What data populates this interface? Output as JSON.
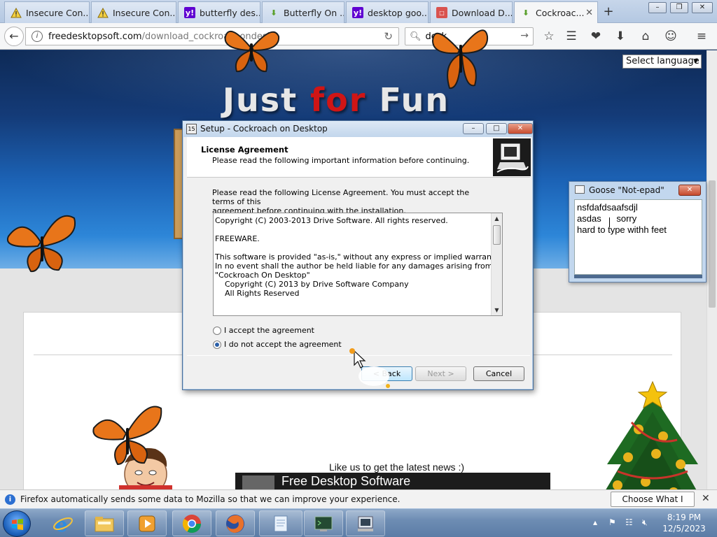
{
  "browser": {
    "tabs": [
      {
        "label": "Insecure Con...",
        "icon": "warning-icon"
      },
      {
        "label": "Insecure Con...",
        "icon": "warning-icon"
      },
      {
        "label": "butterfly des...",
        "icon": "yahoo-icon"
      },
      {
        "label": "Butterfly On ...",
        "icon": "download-arrow-icon"
      },
      {
        "label": "desktop goo...",
        "icon": "yahoo-icon"
      },
      {
        "label": "Download D...",
        "icon": "site-icon"
      },
      {
        "label": "Cockroac...",
        "icon": "download-arrow-icon",
        "active": true
      }
    ],
    "url_host": "freedesktopsoft.com",
    "url_path": "/download_cockroachondesk",
    "search_value": "desk"
  },
  "page": {
    "language_select": "Select language",
    "title_part1": "Just",
    "title_part2": "for",
    "title_part3": "Fun",
    "like_text": "Like us to get the latest news :)",
    "video_title": "Free Desktop Software"
  },
  "setup_dialog": {
    "title": "Setup - Cockroach on Desktop",
    "header_title": "License Agreement",
    "header_subtitle": "Please read the following important information before continuing.",
    "intro_line1": "Please read the following License Agreement. You must accept the terms of this",
    "intro_line2": "agreement before continuing with the installation.",
    "license_lines": [
      "Copyright (C) 2003-2013 Drive Software. All rights reserved.",
      "",
      "FREEWARE.",
      "",
      "This software is provided \"as-is,\" without any express or implied warranty.",
      "In no event shall the author be held liable for any damages arising from the",
      "\"Cockroach On Desktop\"",
      "    Copyright (C) 2013 by Drive Software Company",
      "    All Rights Reserved"
    ],
    "radio_accept": "I accept the agreement",
    "radio_decline": "I do not accept the agreement",
    "selected_option": "decline",
    "back_button": "< Back",
    "next_button": "Next >",
    "cancel_button": "Cancel"
  },
  "goose_notepad": {
    "title": "Goose \"Not-epad\"",
    "lines": [
      "nsfdafdsaafsdjl",
      "asdas      sorry",
      "hard to type withh feet"
    ]
  },
  "notification": {
    "message": "Firefox automatically sends some data to Mozilla so that we can improve your experience.",
    "button": "Choose What I Share"
  },
  "taskbar": {
    "time": "8:19 PM",
    "date": "12/5/2023",
    "apps": [
      "internet-explorer-icon",
      "file-explorer-icon",
      "media-player-icon",
      "chrome-icon",
      "firefox-icon",
      "notepad-icon",
      "terminal-icon",
      "setup-installer-icon"
    ]
  },
  "colors": {
    "title_red": "#d01515",
    "accent_blue": "#1c63b6"
  }
}
